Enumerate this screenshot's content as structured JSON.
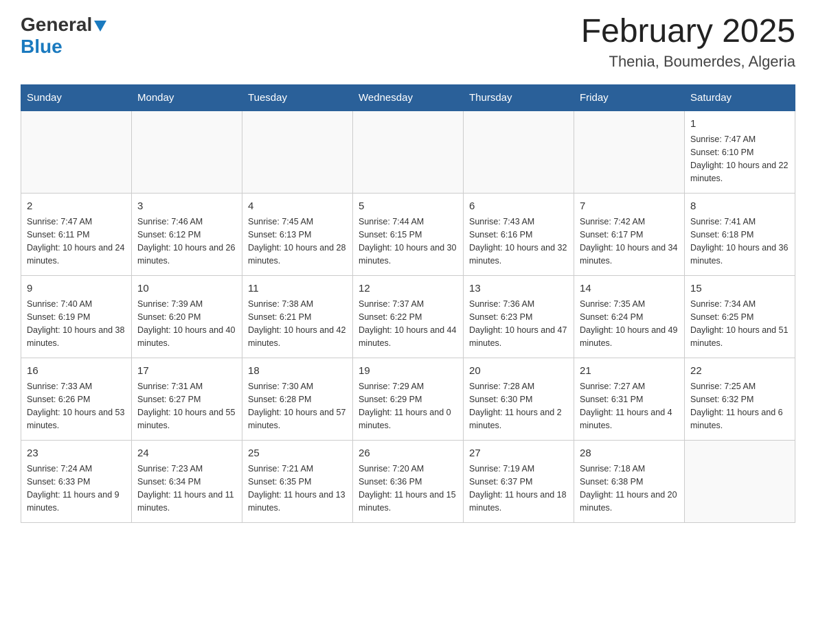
{
  "header": {
    "logo_general": "General",
    "logo_blue": "Blue",
    "month_title": "February 2025",
    "subtitle": "Thenia, Boumerdes, Algeria"
  },
  "days_of_week": [
    "Sunday",
    "Monday",
    "Tuesday",
    "Wednesday",
    "Thursday",
    "Friday",
    "Saturday"
  ],
  "weeks": [
    {
      "days": [
        {
          "num": "",
          "sunrise": "",
          "sunset": "",
          "daylight": "",
          "empty": true
        },
        {
          "num": "",
          "sunrise": "",
          "sunset": "",
          "daylight": "",
          "empty": true
        },
        {
          "num": "",
          "sunrise": "",
          "sunset": "",
          "daylight": "",
          "empty": true
        },
        {
          "num": "",
          "sunrise": "",
          "sunset": "",
          "daylight": "",
          "empty": true
        },
        {
          "num": "",
          "sunrise": "",
          "sunset": "",
          "daylight": "",
          "empty": true
        },
        {
          "num": "",
          "sunrise": "",
          "sunset": "",
          "daylight": "",
          "empty": true
        },
        {
          "num": "1",
          "sunrise": "Sunrise: 7:47 AM",
          "sunset": "Sunset: 6:10 PM",
          "daylight": "Daylight: 10 hours and 22 minutes.",
          "empty": false
        }
      ]
    },
    {
      "days": [
        {
          "num": "2",
          "sunrise": "Sunrise: 7:47 AM",
          "sunset": "Sunset: 6:11 PM",
          "daylight": "Daylight: 10 hours and 24 minutes.",
          "empty": false
        },
        {
          "num": "3",
          "sunrise": "Sunrise: 7:46 AM",
          "sunset": "Sunset: 6:12 PM",
          "daylight": "Daylight: 10 hours and 26 minutes.",
          "empty": false
        },
        {
          "num": "4",
          "sunrise": "Sunrise: 7:45 AM",
          "sunset": "Sunset: 6:13 PM",
          "daylight": "Daylight: 10 hours and 28 minutes.",
          "empty": false
        },
        {
          "num": "5",
          "sunrise": "Sunrise: 7:44 AM",
          "sunset": "Sunset: 6:15 PM",
          "daylight": "Daylight: 10 hours and 30 minutes.",
          "empty": false
        },
        {
          "num": "6",
          "sunrise": "Sunrise: 7:43 AM",
          "sunset": "Sunset: 6:16 PM",
          "daylight": "Daylight: 10 hours and 32 minutes.",
          "empty": false
        },
        {
          "num": "7",
          "sunrise": "Sunrise: 7:42 AM",
          "sunset": "Sunset: 6:17 PM",
          "daylight": "Daylight: 10 hours and 34 minutes.",
          "empty": false
        },
        {
          "num": "8",
          "sunrise": "Sunrise: 7:41 AM",
          "sunset": "Sunset: 6:18 PM",
          "daylight": "Daylight: 10 hours and 36 minutes.",
          "empty": false
        }
      ]
    },
    {
      "days": [
        {
          "num": "9",
          "sunrise": "Sunrise: 7:40 AM",
          "sunset": "Sunset: 6:19 PM",
          "daylight": "Daylight: 10 hours and 38 minutes.",
          "empty": false
        },
        {
          "num": "10",
          "sunrise": "Sunrise: 7:39 AM",
          "sunset": "Sunset: 6:20 PM",
          "daylight": "Daylight: 10 hours and 40 minutes.",
          "empty": false
        },
        {
          "num": "11",
          "sunrise": "Sunrise: 7:38 AM",
          "sunset": "Sunset: 6:21 PM",
          "daylight": "Daylight: 10 hours and 42 minutes.",
          "empty": false
        },
        {
          "num": "12",
          "sunrise": "Sunrise: 7:37 AM",
          "sunset": "Sunset: 6:22 PM",
          "daylight": "Daylight: 10 hours and 44 minutes.",
          "empty": false
        },
        {
          "num": "13",
          "sunrise": "Sunrise: 7:36 AM",
          "sunset": "Sunset: 6:23 PM",
          "daylight": "Daylight: 10 hours and 47 minutes.",
          "empty": false
        },
        {
          "num": "14",
          "sunrise": "Sunrise: 7:35 AM",
          "sunset": "Sunset: 6:24 PM",
          "daylight": "Daylight: 10 hours and 49 minutes.",
          "empty": false
        },
        {
          "num": "15",
          "sunrise": "Sunrise: 7:34 AM",
          "sunset": "Sunset: 6:25 PM",
          "daylight": "Daylight: 10 hours and 51 minutes.",
          "empty": false
        }
      ]
    },
    {
      "days": [
        {
          "num": "16",
          "sunrise": "Sunrise: 7:33 AM",
          "sunset": "Sunset: 6:26 PM",
          "daylight": "Daylight: 10 hours and 53 minutes.",
          "empty": false
        },
        {
          "num": "17",
          "sunrise": "Sunrise: 7:31 AM",
          "sunset": "Sunset: 6:27 PM",
          "daylight": "Daylight: 10 hours and 55 minutes.",
          "empty": false
        },
        {
          "num": "18",
          "sunrise": "Sunrise: 7:30 AM",
          "sunset": "Sunset: 6:28 PM",
          "daylight": "Daylight: 10 hours and 57 minutes.",
          "empty": false
        },
        {
          "num": "19",
          "sunrise": "Sunrise: 7:29 AM",
          "sunset": "Sunset: 6:29 PM",
          "daylight": "Daylight: 11 hours and 0 minutes.",
          "empty": false
        },
        {
          "num": "20",
          "sunrise": "Sunrise: 7:28 AM",
          "sunset": "Sunset: 6:30 PM",
          "daylight": "Daylight: 11 hours and 2 minutes.",
          "empty": false
        },
        {
          "num": "21",
          "sunrise": "Sunrise: 7:27 AM",
          "sunset": "Sunset: 6:31 PM",
          "daylight": "Daylight: 11 hours and 4 minutes.",
          "empty": false
        },
        {
          "num": "22",
          "sunrise": "Sunrise: 7:25 AM",
          "sunset": "Sunset: 6:32 PM",
          "daylight": "Daylight: 11 hours and 6 minutes.",
          "empty": false
        }
      ]
    },
    {
      "days": [
        {
          "num": "23",
          "sunrise": "Sunrise: 7:24 AM",
          "sunset": "Sunset: 6:33 PM",
          "daylight": "Daylight: 11 hours and 9 minutes.",
          "empty": false
        },
        {
          "num": "24",
          "sunrise": "Sunrise: 7:23 AM",
          "sunset": "Sunset: 6:34 PM",
          "daylight": "Daylight: 11 hours and 11 minutes.",
          "empty": false
        },
        {
          "num": "25",
          "sunrise": "Sunrise: 7:21 AM",
          "sunset": "Sunset: 6:35 PM",
          "daylight": "Daylight: 11 hours and 13 minutes.",
          "empty": false
        },
        {
          "num": "26",
          "sunrise": "Sunrise: 7:20 AM",
          "sunset": "Sunset: 6:36 PM",
          "daylight": "Daylight: 11 hours and 15 minutes.",
          "empty": false
        },
        {
          "num": "27",
          "sunrise": "Sunrise: 7:19 AM",
          "sunset": "Sunset: 6:37 PM",
          "daylight": "Daylight: 11 hours and 18 minutes.",
          "empty": false
        },
        {
          "num": "28",
          "sunrise": "Sunrise: 7:18 AM",
          "sunset": "Sunset: 6:38 PM",
          "daylight": "Daylight: 11 hours and 20 minutes.",
          "empty": false
        },
        {
          "num": "",
          "sunrise": "",
          "sunset": "",
          "daylight": "",
          "empty": true
        }
      ]
    }
  ]
}
